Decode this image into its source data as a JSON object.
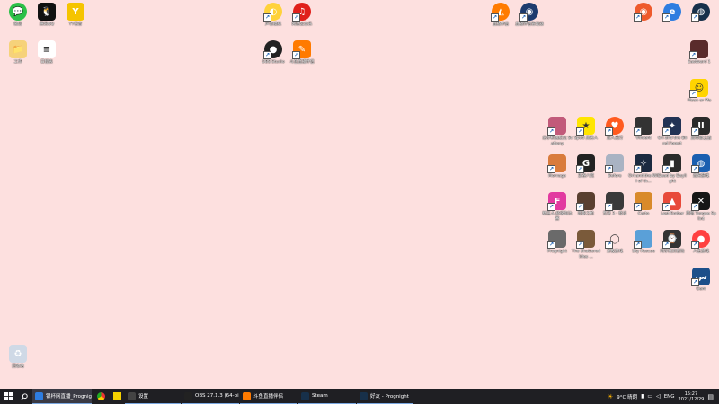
{
  "desktop": {
    "icons": [
      {
        "id": "wechat",
        "label": "微信",
        "color": "#2bc048",
        "glyph": "💬"
      },
      {
        "id": "qq",
        "label": "腾讯QQ",
        "color": "#111111",
        "glyph": "🐧"
      },
      {
        "id": "yy",
        "label": "YY语音",
        "color": "#f5c400",
        "glyph": "Y"
      },
      {
        "id": "work",
        "label": "工作",
        "color": "#f6d27a",
        "glyph": "📁"
      },
      {
        "id": "textdoc",
        "label": "日程表",
        "color": "#ffffff",
        "glyph": "≡"
      },
      {
        "id": "voicemeeter",
        "label": "声音模拟",
        "color": "#ffd23a",
        "glyph": "◐"
      },
      {
        "id": "netease",
        "label": "网易云音乐",
        "color": "#e0201b",
        "glyph": "♫"
      },
      {
        "id": "obs",
        "label": "OBS Studio",
        "color": "#222222",
        "glyph": "●"
      },
      {
        "id": "live",
        "label": "斗鱼直播伴侣",
        "color": "#ff7a00",
        "glyph": "✎"
      },
      {
        "id": "app1",
        "label": "直播伴侣",
        "color": "#ff7b00",
        "glyph": "◭"
      },
      {
        "id": "app2",
        "label": "直播伴侣管理器",
        "color": "#1d3b6e",
        "glyph": "◉"
      },
      {
        "id": "app3",
        "label": "",
        "color": "#ee5a2c",
        "glyph": "◉"
      },
      {
        "id": "edge",
        "label": "",
        "color": "#2e7de0",
        "glyph": "e"
      },
      {
        "id": "steam",
        "label": "",
        "color": "#17304a",
        "glyph": "◍"
      },
      {
        "id": "g1",
        "label": "Eastward 1",
        "color": "#5a2b2b",
        "glyph": ""
      },
      {
        "id": "g2",
        "label": "Moon or Me",
        "color": "#ffd400",
        "glyph": "☺"
      },
      {
        "id": "g3",
        "label": "尼尔机械纪元 Stationy",
        "color": "#c25a7a",
        "glyph": ""
      },
      {
        "id": "g4",
        "label": "Spud 真男人",
        "color": "#ffe500",
        "glyph": "★"
      },
      {
        "id": "g5",
        "label": "双人成行",
        "color": "#ff5a1f",
        "glyph": "♥"
      },
      {
        "id": "g6",
        "label": "Vincent",
        "color": "#333333",
        "glyph": ""
      },
      {
        "id": "g7",
        "label": "Ori and the Blind Forest",
        "color": "#223355",
        "glyph": "✦"
      },
      {
        "id": "g8",
        "label": "黑帝斯之战",
        "color": "#2a2a2a",
        "glyph": "II"
      },
      {
        "id": "g9",
        "label": "Mornage",
        "color": "#d97b3c",
        "glyph": ""
      },
      {
        "id": "g10",
        "label": "鬼谷八荒",
        "color": "#222222",
        "glyph": "G"
      },
      {
        "id": "g11",
        "label": "Before",
        "color": "#a9b3c3",
        "glyph": ""
      },
      {
        "id": "g12",
        "label": "Ori and the Will of th...",
        "color": "#1b2a40",
        "glyph": "✧"
      },
      {
        "id": "g13",
        "label": "Dead by Daylight",
        "color": "#2b2b2b",
        "glyph": "▮"
      },
      {
        "id": "g14",
        "label": "恐怖游戏",
        "color": "#1b5fb0",
        "glyph": "◍"
      },
      {
        "id": "g15",
        "label": "糖豆人:终极淘汰赛",
        "color": "#e23aa0",
        "glyph": "F"
      },
      {
        "id": "g16",
        "label": "暗影之枪",
        "color": "#5a4030",
        "glyph": ""
      },
      {
        "id": "g17",
        "label": "无尽 3 · 怪谈",
        "color": "#3a3a3a",
        "glyph": ""
      },
      {
        "id": "g18",
        "label": "Carto",
        "color": "#d98a2a",
        "glyph": ""
      },
      {
        "id": "g19",
        "label": "Lost Ember",
        "color": "#e84a3a",
        "glyph": "▲"
      },
      {
        "id": "g20",
        "label": "黑暗 Tongue Splint",
        "color": "#161616",
        "glyph": "✕"
      },
      {
        "id": "g21",
        "label": "Prognight",
        "color": "#6a6a6a",
        "glyph": ""
      },
      {
        "id": "g22",
        "label": "The Shattered Isles ...",
        "color": "#7a5a3a",
        "glyph": ""
      },
      {
        "id": "g23",
        "label": "深夜游戏",
        "color": "#fde0df",
        "glyph": "◯"
      },
      {
        "id": "g24",
        "label": "Sky Rescue",
        "color": "#5aa0d8",
        "glyph": ""
      },
      {
        "id": "g25",
        "label": "阿尔托的冒险",
        "color": "#333333",
        "glyph": "⌚"
      },
      {
        "id": "g26",
        "label": "人生游戏",
        "color": "#ff4040",
        "glyph": "●"
      },
      {
        "id": "g27",
        "label": "Gem",
        "color": "#1c4f8a",
        "glyph": "س"
      },
      {
        "id": "recycle",
        "label": "回收站",
        "color": "#cfd9e6",
        "glyph": "♻"
      }
    ]
  },
  "taskbar": {
    "apps": [
      {
        "label": "银杯网直播_Prognight",
        "color": "#2e7de0",
        "active": true
      },
      {
        "label": "设置",
        "color": "#444444",
        "active": false
      },
      {
        "label": "OBS 27.1.3 (64-bi...",
        "color": "#222222",
        "active": false
      },
      {
        "label": "斗鱼直播伴侣",
        "color": "#ff7a00",
        "active": false
      },
      {
        "label": "Steam",
        "color": "#17304a",
        "active": false
      },
      {
        "label": "好友 - Prognight",
        "color": "#17304a",
        "active": false
      }
    ],
    "tray": {
      "weather": "9°C 晴朗",
      "lang": "ENG",
      "time": "15:27",
      "date": "2021/12/29"
    }
  }
}
